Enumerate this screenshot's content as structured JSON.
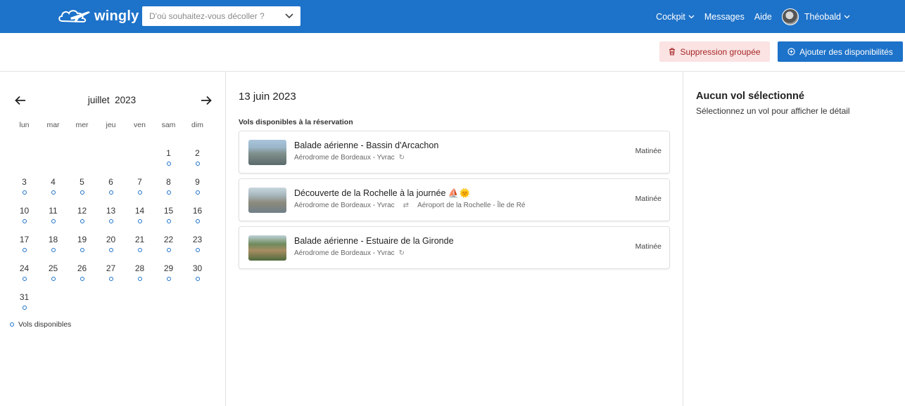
{
  "header": {
    "brand": "wingly",
    "search_placeholder": "D'où souhaitez-vous décoller ?",
    "nav": {
      "cockpit": "Cockpit",
      "messages": "Messages",
      "aide": "Aide",
      "user": "Théobald"
    }
  },
  "toolbar": {
    "delete_label": "Suppression groupée",
    "add_label": "Ajouter des disponibilités"
  },
  "calendar": {
    "month": "juillet",
    "year": "2023",
    "weekdays": [
      "lun",
      "mar",
      "mer",
      "jeu",
      "ven",
      "sam",
      "dim"
    ],
    "legend": "Vols disponibles"
  },
  "main": {
    "date_title": "13 juin 2023",
    "section_label": "Vols disponibles à la réservation",
    "flights": [
      {
        "title": "Balade aérienne - Bassin d'Arcachon",
        "departure": "Aérodrome de Bordeaux - Yvrac",
        "arrival": "",
        "period": "Matinée"
      },
      {
        "title": "Découverte de la Rochelle à la journée ⛵🌞",
        "departure": "Aérodrome de Bordeaux - Yvrac",
        "arrival": "Aéroport de la Rochelle - Île de Ré",
        "period": "Matinée"
      },
      {
        "title": "Balade aérienne - Estuaire de la Gironde",
        "departure": "Aérodrome de Bordeaux - Yvrac",
        "arrival": "",
        "period": "Matinée"
      }
    ]
  },
  "detail": {
    "title": "Aucun vol sélectionné",
    "subtitle": "Sélectionnez un vol pour afficher le détail"
  },
  "colors": {
    "primary": "#1d72c9",
    "danger_bg": "#fbe3e3",
    "danger_text": "#a62525"
  }
}
